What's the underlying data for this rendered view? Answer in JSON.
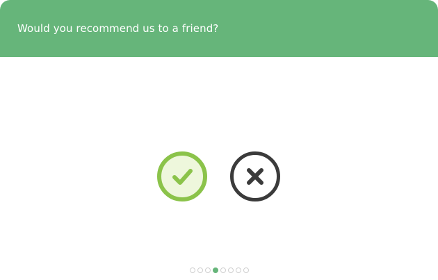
{
  "header": {
    "title": "Would you recommend us to a friend?",
    "background_color": "#66b57a"
  },
  "choices": {
    "yes": {
      "icon": "checkmark-icon",
      "ring_color": "#8bc34a",
      "fill_color": "#eef7dc"
    },
    "no": {
      "icon": "close-icon",
      "ring_color": "#3b3b3b"
    }
  },
  "pagination": {
    "total": 8,
    "current": 4,
    "active_color": "#66b57a",
    "inactive_border_color": "#cfcfcf"
  }
}
